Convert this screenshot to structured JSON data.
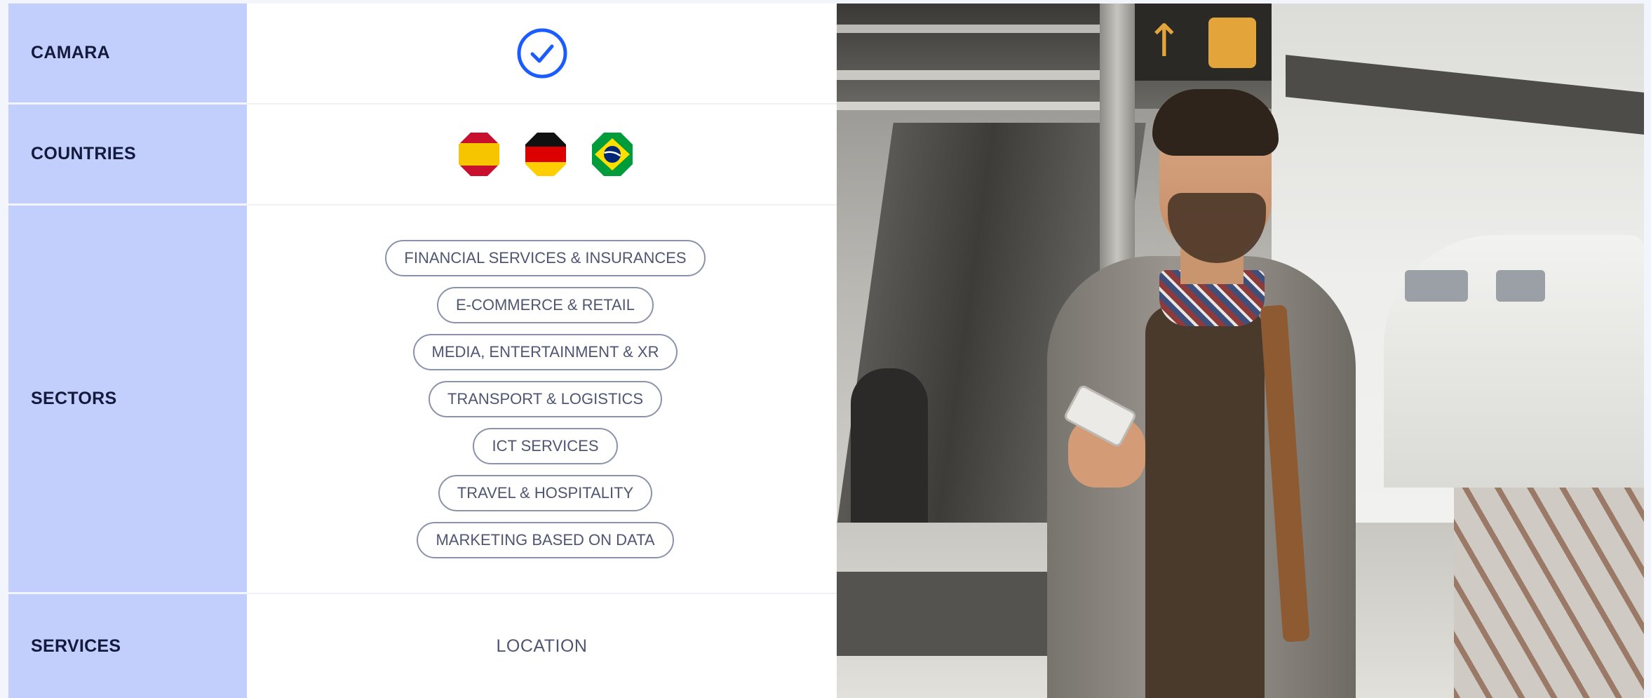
{
  "rows": {
    "camara": {
      "label": "CAMARA",
      "icon": "check-circle-icon",
      "icon_color": "#1a5cff"
    },
    "countries": {
      "label": "COUNTRIES",
      "flags": [
        {
          "name": "spain-flag-icon"
        },
        {
          "name": "germany-flag-icon"
        },
        {
          "name": "brazil-flag-icon"
        }
      ]
    },
    "sectors": {
      "label": "SECTORS",
      "items": [
        "FINANCIAL SERVICES & INSURANCES",
        "E-COMMERCE & RETAIL",
        "MEDIA, ENTERTAINMENT & XR",
        "TRANSPORT & LOGISTICS",
        "ICT SERVICES",
        "TRAVEL & HOSPITALITY",
        "MARKETING BASED ON DATA"
      ]
    },
    "services": {
      "label": "SERVICES",
      "value": "LOCATION"
    }
  },
  "colors": {
    "label_background": "#c2cffd",
    "accent": "#1a5cff",
    "pill_border": "#8a93ab"
  },
  "photo": {
    "subject": "man-with-smartphone-photo"
  }
}
